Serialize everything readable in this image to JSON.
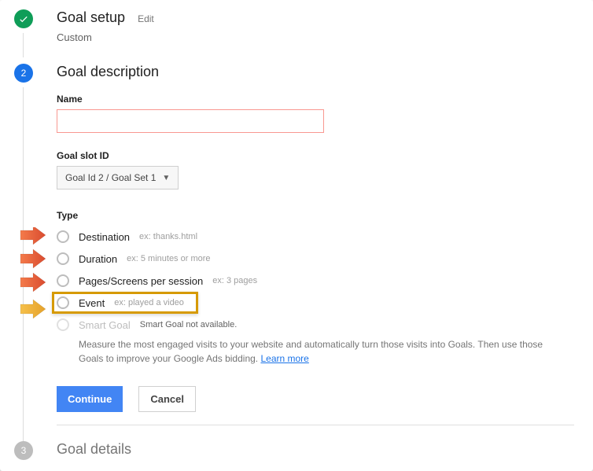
{
  "steps": {
    "setup": {
      "title": "Goal setup",
      "edit": "Edit",
      "subtitle": "Custom"
    },
    "description": {
      "number": "2",
      "title": "Goal description",
      "name_label": "Name",
      "slot_label": "Goal slot ID",
      "slot_value": "Goal Id 2 / Goal Set 1",
      "type_label": "Type",
      "types": {
        "destination": {
          "label": "Destination",
          "hint": "ex: thanks.html"
        },
        "duration": {
          "label": "Duration",
          "hint": "ex: 5 minutes or more"
        },
        "pages": {
          "label": "Pages/Screens per session",
          "hint": "ex: 3 pages"
        },
        "event": {
          "label": "Event",
          "hint": "ex: played a video"
        },
        "smart": {
          "label": "Smart Goal",
          "hint": "Smart Goal not available."
        }
      },
      "smart_desc": "Measure the most engaged visits to your website and automatically turn those visits into Goals. Then use those Goals to improve your Google Ads bidding. ",
      "learn_more": "Learn more",
      "continue": "Continue",
      "cancel": "Cancel"
    },
    "details": {
      "number": "3",
      "title": "Goal details"
    }
  }
}
